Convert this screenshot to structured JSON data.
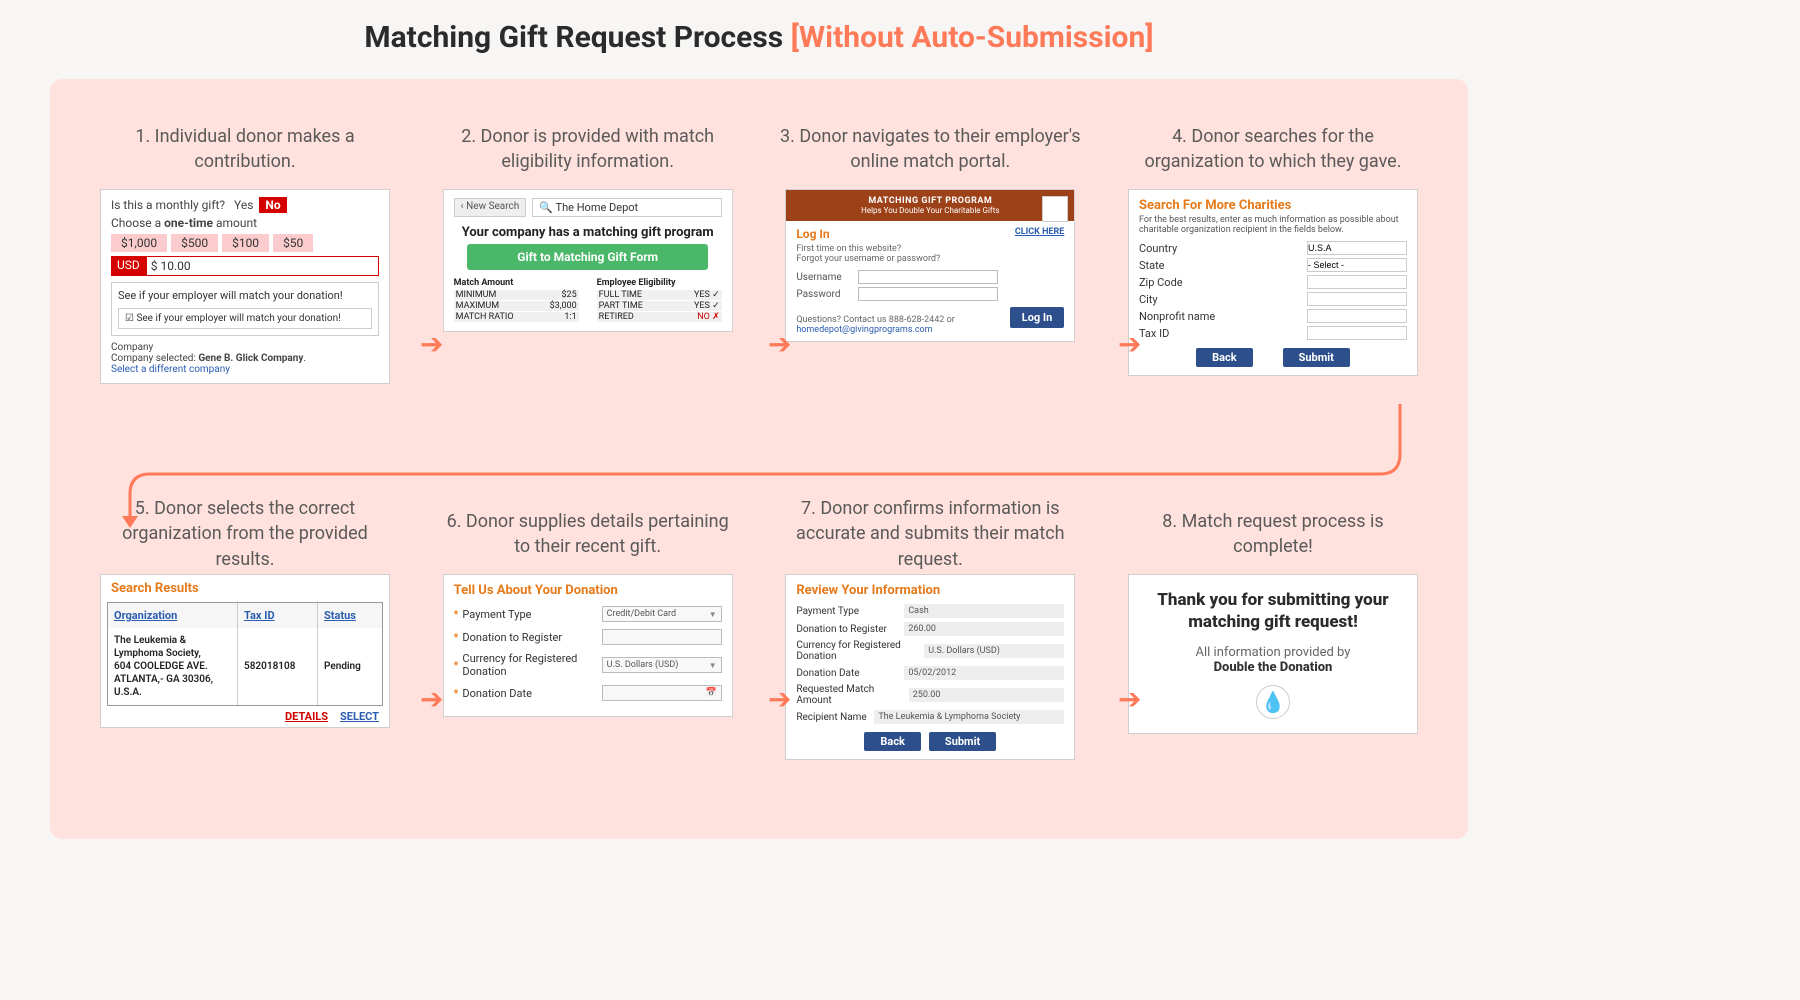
{
  "title_main": "Matching Gift Request Process ",
  "title_highlight": "[Without Auto-Submission]",
  "steps": {
    "s1": "1. Individual donor makes a contribution.",
    "s2": "2. Donor is provided with match eligibility information.",
    "s3": "3. Donor navigates to their employer's online match portal.",
    "s4": "4. Donor searches for the organization to which they gave.",
    "s5": "5. Donor selects the correct organization from the provided results.",
    "s6": "6. Donor supplies details pertaining to their recent gift.",
    "s7": "7. Donor confirms information is accurate and submits their match request.",
    "s8": "8. Match request process is complete!"
  },
  "card1": {
    "monthly_q": "Is this a monthly gift?",
    "yes": "Yes",
    "no": "No",
    "choose_pre": "Choose a ",
    "choose_b": "one-time",
    "choose_post": " amount",
    "amounts": [
      "$1,000",
      "$500",
      "$100",
      "$50"
    ],
    "usd": "USD",
    "usd_val": "$ 10.00",
    "emp_line": "See if your employer will match your donation!",
    "emp_check": "☑ See if your employer will match your donation!",
    "company_label": "Company",
    "company_sel_pre": "Company selected: ",
    "company_sel_name": "Gene B. Glick Company",
    "company_change": "Select a different company"
  },
  "card2": {
    "new_search": "‹ New Search",
    "search_text": "The Home Depot",
    "found": "Your company has a matching gift program",
    "cta": "Gift to Matching Gift Form",
    "match_hdr": "Match Amount",
    "elig_hdr": "Employee Eligibility",
    "min_l": "MINIMUM",
    "min_v": "$25",
    "max_l": "MAXIMUM",
    "max_v": "$3,000",
    "ratio_l": "MATCH RATIO",
    "ratio_v": "1:1",
    "ft_l": "FULL TIME",
    "ft_v": "YES ✓",
    "pt_l": "PART TIME",
    "pt_v": "YES ✓",
    "rt_l": "RETIRED",
    "rt_v": "NO ✗"
  },
  "card3": {
    "banner_t": "MATCHING GIFT PROGRAM",
    "banner_s": "Helps You Double Your Charitable Gifts",
    "login": "Log In",
    "click": "CLICK HERE",
    "note1": "First time on this website?",
    "note2": "Forgot your username or password?",
    "user": "Username",
    "pass": "Password",
    "login_btn": "Log In",
    "footer_pre": "Questions? Contact us 888-628-2442 or ",
    "footer_link": "homedepot@givingprograms.com"
  },
  "card4": {
    "hdr": "Search For More Charities",
    "note": "For the best results, enter as much information as possible about charitable organization recipient in the fields below.",
    "country": "Country",
    "country_v": "U.S.A",
    "state": "State",
    "state_v": "- Select -",
    "zip": "Zip Code",
    "city": "City",
    "np": "Nonprofit name",
    "tax": "Tax ID",
    "back": "Back",
    "submit": "Submit"
  },
  "card5": {
    "hdr": "Search Results",
    "col_org": "Organization",
    "col_tax": "Tax ID",
    "col_st": "Status",
    "org": "The Leukemia & Lymphoma Society,\n604 COOLEDGE AVE. ATLANTA,- GA 30306, U.S.A.",
    "tax": "582018108",
    "status": "Pending",
    "details": "DETAILS",
    "select": "SELECT"
  },
  "card6": {
    "hdr": "Tell Us About Your Donation",
    "pay": "Payment Type",
    "pay_v": "Credit/Debit Card",
    "don": "Donation to Register",
    "cur": "Currency for Registered Donation",
    "cur_v": "U.S. Dollars (USD)",
    "date": "Donation Date"
  },
  "card7": {
    "hdr": "Review Your Information",
    "pay_l": "Payment Type",
    "pay_v": "Cash",
    "don_l": "Donation to Register",
    "don_v": "260.00",
    "cur_l": "Currency for Registered Donation",
    "cur_v": "U.S. Dollars (USD)",
    "date_l": "Donation Date",
    "date_v": "05/02/2012",
    "req_l": "Requested Match Amount",
    "req_v": "250.00",
    "rec_l": "Recipient Name",
    "rec_v": "The Leukemia & Lymphoma Society",
    "back": "Back",
    "submit": "Submit"
  },
  "card8": {
    "thanks": "Thank you for submitting your matching gift request!",
    "by_pre": "All information provided by",
    "by_name": "Double the Donation"
  }
}
